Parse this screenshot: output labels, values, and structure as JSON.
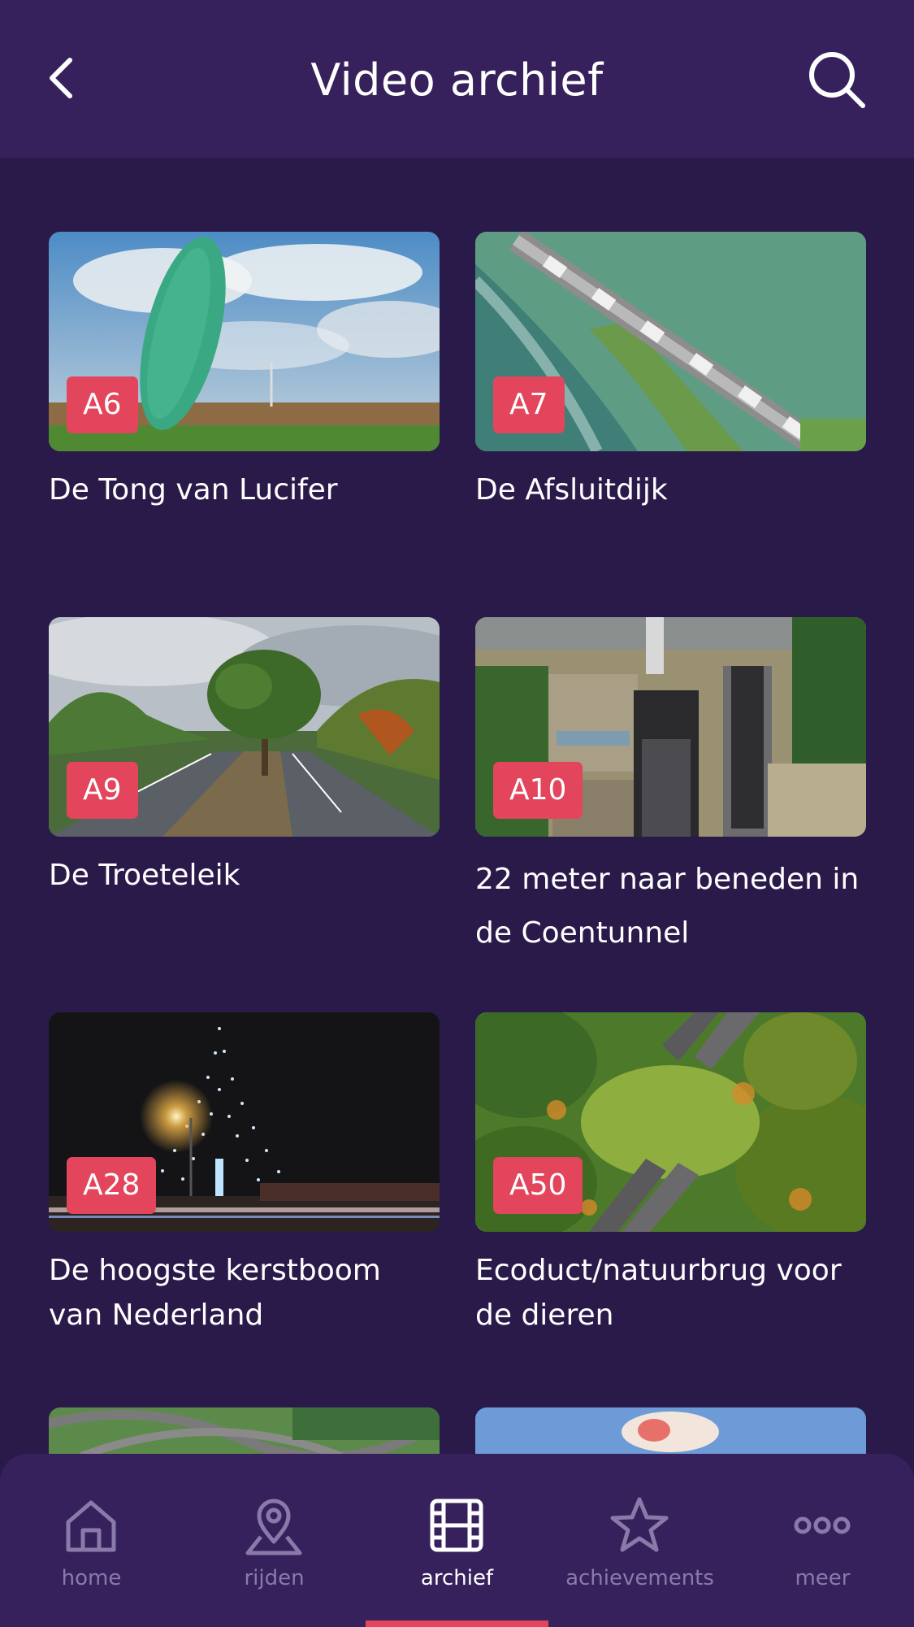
{
  "header": {
    "title": "Video archief",
    "back_icon": "chevron-left-icon",
    "search_icon": "search-icon"
  },
  "videos": [
    {
      "road": "A6",
      "title": "De Tong van Lucifer"
    },
    {
      "road": "A7",
      "title": "De Afsluitdijk"
    },
    {
      "road": "A9",
      "title": "De Troeteleik"
    },
    {
      "road": "A10",
      "title": "22 meter naar beneden in de Coentunnel"
    },
    {
      "road": "A28",
      "title": "De hoogste kerstboom van Nederland"
    },
    {
      "road": "A50",
      "title": "Ecoduct/natuurbrug voor de dieren"
    }
  ],
  "tabbar": {
    "items": [
      {
        "label": "home",
        "icon": "home-icon"
      },
      {
        "label": "rijden",
        "icon": "map-pin-icon"
      },
      {
        "label": "archief",
        "icon": "film-icon"
      },
      {
        "label": "achievements",
        "icon": "star-icon"
      },
      {
        "label": "meer",
        "icon": "more-dots-icon"
      }
    ],
    "active": "archief"
  },
  "colors": {
    "background": "#2a1a4a",
    "header": "#36215c",
    "accent": "#e2455c",
    "tab_inactive": "#8a7aaa"
  }
}
